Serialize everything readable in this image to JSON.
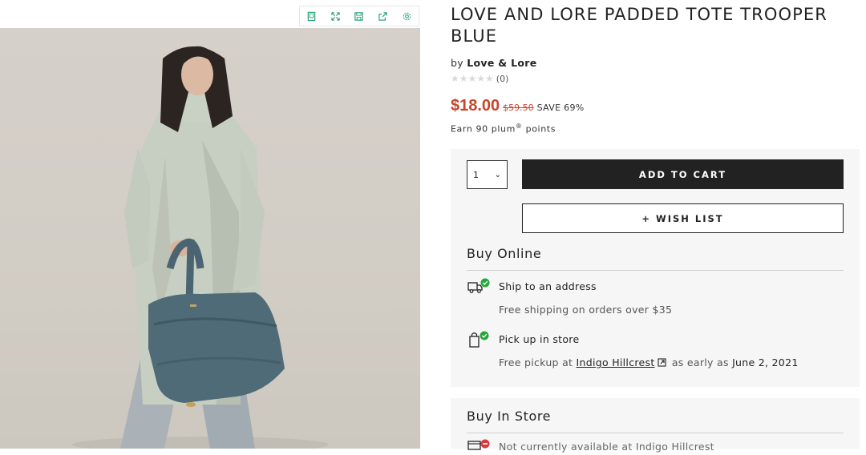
{
  "toolbar": {
    "icons": [
      "device-icon",
      "expand-icon",
      "save-icon",
      "share-icon",
      "settings-icon"
    ]
  },
  "product": {
    "title": "LOVE AND LORE PADDED TOTE TROOPER BLUE",
    "by_prefix": "by",
    "brand": "Love & Lore",
    "stars": "★★★★★",
    "review_count": "(0)",
    "price": "$18.00",
    "was_price": "$59.50",
    "save_text": "SAVE 69%",
    "points_prefix": "Earn 90 plum",
    "points_reg": "®",
    "points_suffix": "points"
  },
  "purchase": {
    "qty_value": "1",
    "add_to_cart": "ADD TO CART",
    "wish_list": "+ WISH LIST"
  },
  "buy_online": {
    "title": "Buy Online",
    "ship_label": "Ship to an address",
    "ship_sub": "Free shipping on orders over $35",
    "pickup_label": "Pick up in store",
    "pickup_prefix": "Free pickup at",
    "store_name": "Indigo Hillcrest",
    "pickup_mid": "as early as",
    "pickup_date": "June 2, 2021"
  },
  "buy_in_store": {
    "title": "Buy In Store",
    "status": "Not currently available at Indigo Hillcrest"
  },
  "colors": {
    "price_red": "#c9442a",
    "accent_green": "#2fa37a",
    "check_green": "#22a83a",
    "unavailable_red": "#d63a3a"
  }
}
